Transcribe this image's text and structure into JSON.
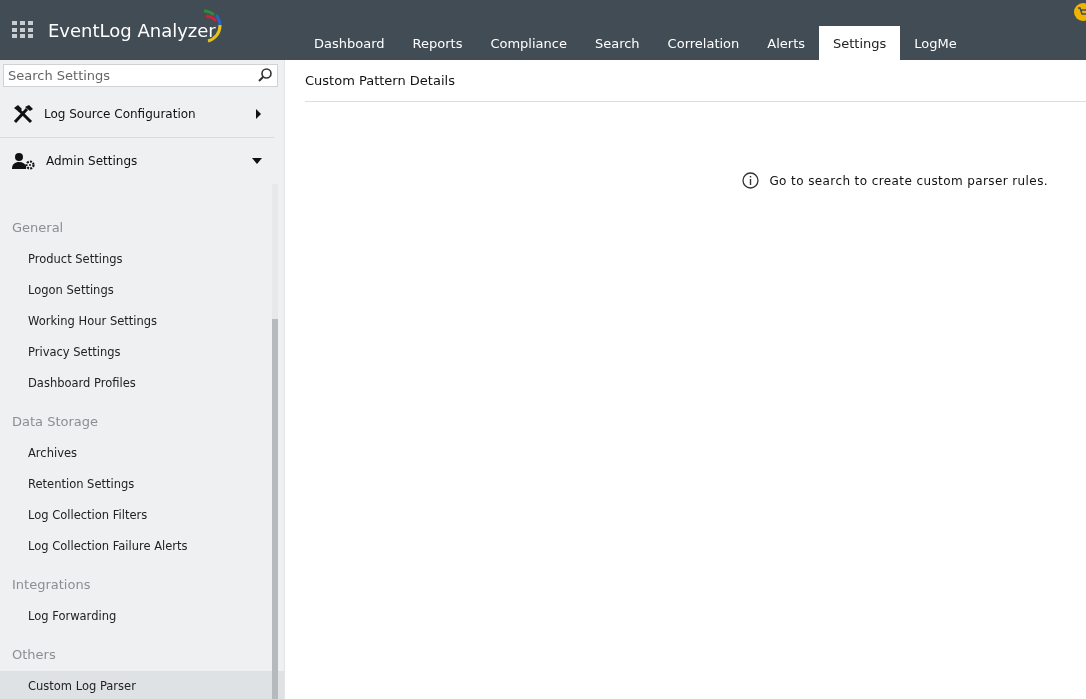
{
  "header": {
    "title": "EventLog Analyzer",
    "tabs": [
      {
        "label": "Dashboard",
        "selected": false
      },
      {
        "label": "Reports",
        "selected": false
      },
      {
        "label": "Compliance",
        "selected": false
      },
      {
        "label": "Search",
        "selected": false
      },
      {
        "label": "Correlation",
        "selected": false
      },
      {
        "label": "Alerts",
        "selected": false
      },
      {
        "label": "Settings",
        "selected": true
      },
      {
        "label": "LogMe",
        "selected": false
      }
    ]
  },
  "sidebar": {
    "search": {
      "placeholder": "Search Settings"
    },
    "sections": [
      {
        "label": "Log Source Configuration",
        "kind": "tools",
        "expanded": false
      },
      {
        "label": "Admin Settings",
        "kind": "admin",
        "expanded": true
      }
    ],
    "groups": [
      {
        "title": "General",
        "items": [
          {
            "label": "Product Settings",
            "selected": false
          },
          {
            "label": "Logon Settings",
            "selected": false
          },
          {
            "label": "Working Hour Settings",
            "selected": false
          },
          {
            "label": "Privacy Settings",
            "selected": false
          },
          {
            "label": "Dashboard Profiles",
            "selected": false
          }
        ]
      },
      {
        "title": "Data Storage",
        "items": [
          {
            "label": "Archives",
            "selected": false
          },
          {
            "label": "Retention Settings",
            "selected": false
          },
          {
            "label": "Log Collection Filters",
            "selected": false
          },
          {
            "label": "Log Collection Failure Alerts",
            "selected": false
          }
        ]
      },
      {
        "title": "Integrations",
        "items": [
          {
            "label": "Log Forwarding",
            "selected": false
          }
        ]
      },
      {
        "title": "Others",
        "items": [
          {
            "label": "Custom Log Parser",
            "selected": true
          }
        ]
      }
    ]
  },
  "content": {
    "title": "Custom Pattern Details",
    "message": "Go to search to create custom parser rules."
  }
}
